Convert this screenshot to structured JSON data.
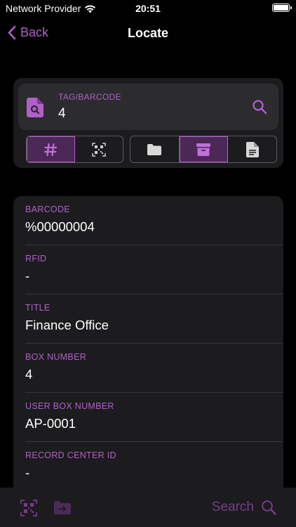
{
  "status_bar": {
    "carrier": "Network Provider",
    "time": "20:51"
  },
  "nav": {
    "back_label": "Back",
    "title": "Locate"
  },
  "search": {
    "label": "TAG/BARCODE",
    "value": "4"
  },
  "segments": {
    "group1": [
      {
        "icon": "hash-icon",
        "active": true
      },
      {
        "icon": "qr-code-icon",
        "active": false
      }
    ],
    "group2": [
      {
        "icon": "folder-icon",
        "active": false
      },
      {
        "icon": "archive-box-icon",
        "active": true
      },
      {
        "icon": "document-icon",
        "active": false
      }
    ]
  },
  "details": [
    {
      "label": "BARCODE",
      "value": "%00000004"
    },
    {
      "label": "RFID",
      "value": "-"
    },
    {
      "label": "TITLE",
      "value": "Finance Office"
    },
    {
      "label": "BOX NUMBER",
      "value": "4"
    },
    {
      "label": "USER BOX NUMBER",
      "value": "AP-0001"
    },
    {
      "label": "RECORD CENTER ID",
      "value": "-"
    }
  ],
  "toolbar": {
    "search_label": "Search"
  },
  "colors": {
    "accent": "#b060c8",
    "accent_dim": "#7a3a8e",
    "card": "#1c1c1e",
    "input": "#2c2c2e",
    "active_segment": "#4b2856"
  }
}
